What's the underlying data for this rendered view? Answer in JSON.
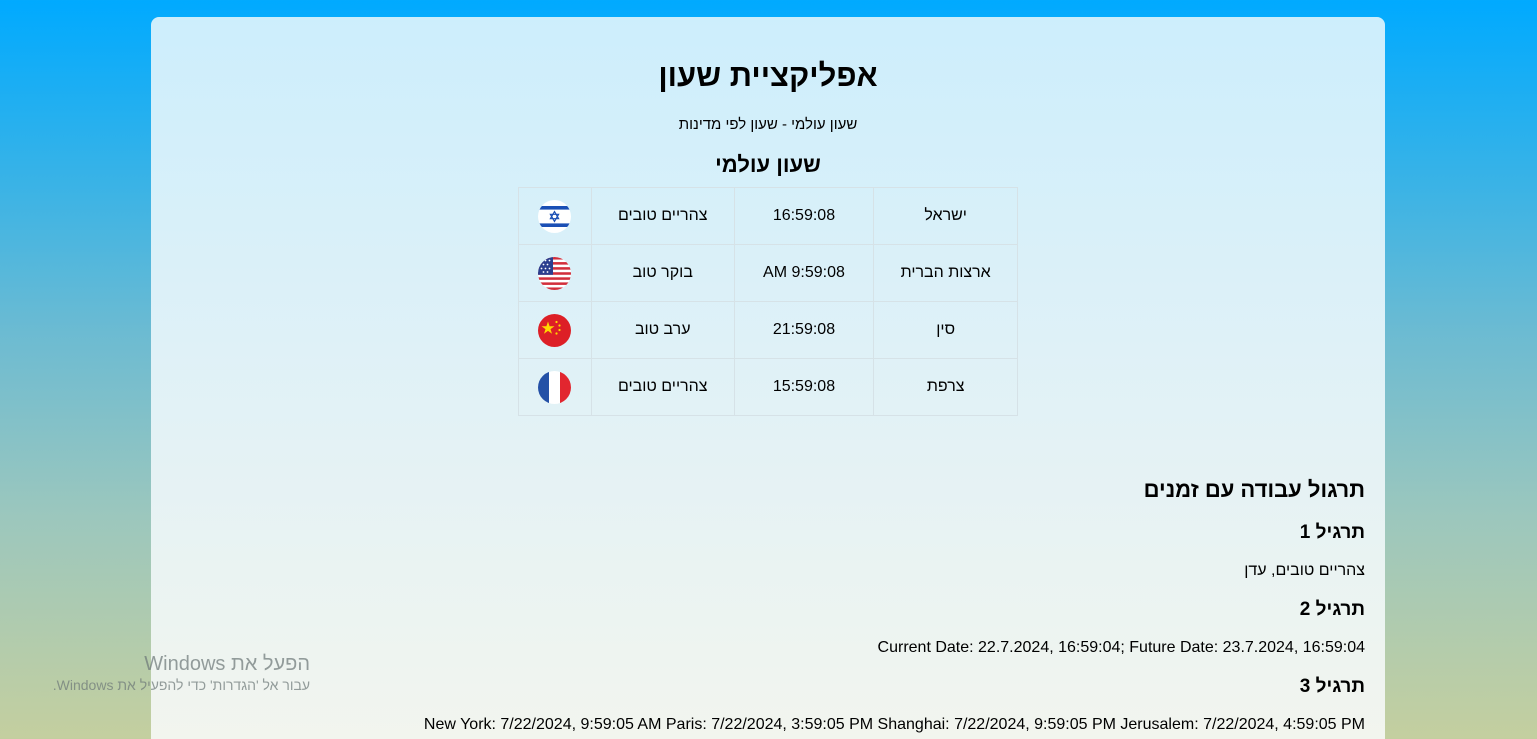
{
  "header": {
    "title": "אפליקציית שעון",
    "subtitle": "שעון עולמי - שעון לפי מדינות"
  },
  "world_clock": {
    "title": "שעון עולמי",
    "rows": [
      {
        "flag_icon": "israel-flag-icon",
        "greeting": "צהריים טובים",
        "time": "16:59:08",
        "country": "ישראל"
      },
      {
        "flag_icon": "usa-flag-icon",
        "greeting": "בוקר טוב",
        "time": "9:59:08 AM",
        "country": "ארצות הברית"
      },
      {
        "flag_icon": "china-flag-icon",
        "greeting": "ערב טוב",
        "time": "21:59:08",
        "country": "סין"
      },
      {
        "flag_icon": "france-flag-icon",
        "greeting": "צהריים טובים",
        "time": "15:59:08",
        "country": "צרפת"
      }
    ]
  },
  "exercises": {
    "title": "תרגול עבודה עם זמנים",
    "items": [
      {
        "title": "תרגיל 1",
        "text": "צהריים טובים, עדן"
      },
      {
        "title": "תרגיל 2",
        "text": "Current Date: 22.7.2024, 16:59:04; Future Date: 23.7.2024, 16:59:04"
      },
      {
        "title": "תרגיל 3",
        "text": "New York: 7/22/2024, 9:59:05 AM Paris: 7/22/2024, 3:59:05 PM Shanghai: 7/22/2024, 9:59:05 PM Jerusalem: 7/22/2024, 4:59:05 PM"
      }
    ]
  },
  "watermark": {
    "title": "הפעל את Windows",
    "subtitle": "עבור אל 'הגדרות' כדי להפעיל את Windows."
  },
  "colors": {
    "background_top": "#00aaff",
    "background_bottom": "#c4cf9f",
    "table_border": "#d6e2e7"
  }
}
